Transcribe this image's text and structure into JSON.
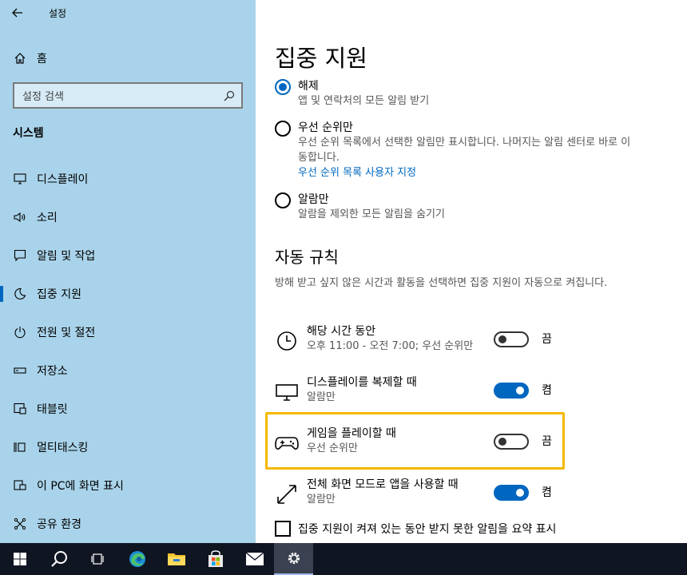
{
  "window": {
    "title": "설정"
  },
  "sidebar": {
    "home_label": "홈",
    "search_placeholder": "설정 검색",
    "section_title": "시스템",
    "items": [
      {
        "label": "디스플레이",
        "icon": "monitor-icon"
      },
      {
        "label": "소리",
        "icon": "speaker-icon"
      },
      {
        "label": "알림 및 작업",
        "icon": "notification-icon"
      },
      {
        "label": "집중 지원",
        "icon": "moon-icon",
        "active": true
      },
      {
        "label": "전원 및 절전",
        "icon": "power-icon"
      },
      {
        "label": "저장소",
        "icon": "storage-icon"
      },
      {
        "label": "태블릿",
        "icon": "tablet-icon"
      },
      {
        "label": "멀티태스킹",
        "icon": "multitasking-icon"
      },
      {
        "label": "이 PC에 화면 표시",
        "icon": "project-icon"
      },
      {
        "label": "공유 환경",
        "icon": "shared-icon"
      }
    ]
  },
  "main": {
    "title": "집중 지원",
    "options": [
      {
        "label": "해제",
        "desc": "앱 및 연락처의 모든 알림 받기",
        "selected": true
      },
      {
        "label": "우선 순위만",
        "desc": "우선 순위 목록에서 선택한 알림만 표시합니다. 나머지는 알림 센터로 바로 이동합니다.",
        "link": "우선 순위 목록 사용자 지정",
        "selected": false
      },
      {
        "label": "알람만",
        "desc": "알람을 제외한 모든 알림을 숨기기",
        "selected": false
      }
    ],
    "auto_rules_title": "자동 규칙",
    "auto_rules_desc": "방해 받고 싶지 않은 시간과 활동을 선택하면 집중 지원이 자동으로 켜집니다.",
    "rules": [
      {
        "name": "해당 시간 동안",
        "sub": "오후 11:00 - 오전 7:00; 우선 순위만",
        "state": "끔",
        "on": false,
        "icon": "clock-icon"
      },
      {
        "name": "디스플레이를 복제할 때",
        "sub": "알람만",
        "state": "켬",
        "on": true,
        "icon": "monitor-icon"
      },
      {
        "name": "게임을 플레이할 때",
        "sub": "우선 순위만",
        "state": "끔",
        "on": false,
        "icon": "gamepad-icon"
      },
      {
        "name": "전체 화면 모드로 앱을 사용할 때",
        "sub": "알람만",
        "state": "켬",
        "on": true,
        "icon": "fullscreen-icon"
      }
    ],
    "checkbox_label": "집중 지원이 켜져 있는 동안 받지 못한 알림을 요약 표시"
  },
  "taskbar": {
    "items": [
      "windows-start-icon",
      "search-icon",
      "task-view-icon",
      "edge-icon",
      "file-explorer-icon",
      "store-icon",
      "mail-icon",
      "settings-gear-icon"
    ]
  },
  "colors": {
    "sidebar_bg": "#a9d3ea",
    "accent": "#0067c0",
    "highlight": "#f5b800",
    "taskbar_bg": "#101522"
  }
}
